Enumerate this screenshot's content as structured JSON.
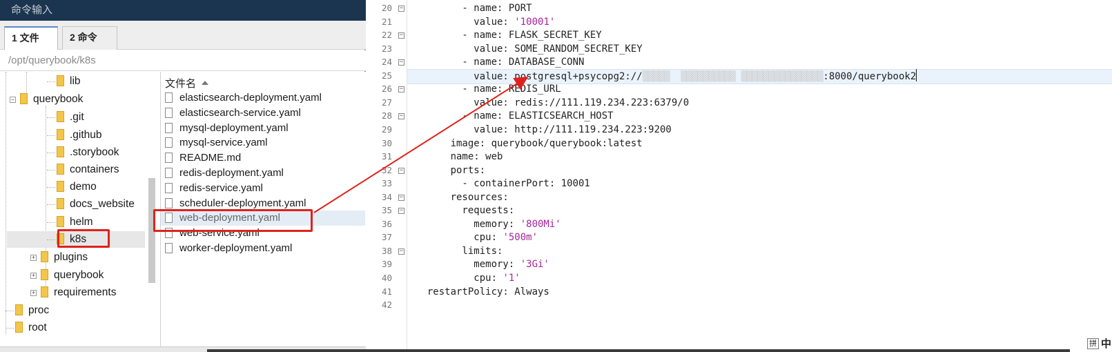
{
  "window": {
    "title": "命令输入"
  },
  "tabs": [
    {
      "label": "1 文件"
    },
    {
      "label": "2 命令"
    }
  ],
  "path": "/opt/querybook/k8s",
  "tree": {
    "items": [
      {
        "label": "lib"
      },
      {
        "label": "querybook",
        "expander": "−"
      },
      {
        "label": ".git"
      },
      {
        "label": ".github"
      },
      {
        "label": ".storybook"
      },
      {
        "label": "containers"
      },
      {
        "label": "demo"
      },
      {
        "label": "docs_website"
      },
      {
        "label": "helm"
      },
      {
        "label": "k8s"
      },
      {
        "label": "plugins",
        "expander": "+"
      },
      {
        "label": "querybook",
        "expander": "+"
      },
      {
        "label": "requirements",
        "expander": "+"
      },
      {
        "label": "proc"
      },
      {
        "label": "root"
      }
    ]
  },
  "filelist": {
    "column_header": "文件名",
    "files": [
      "elasticsearch-deployment.yaml",
      "elasticsearch-service.yaml",
      "mysql-deployment.yaml",
      "mysql-service.yaml",
      "README.md",
      "redis-deployment.yaml",
      "redis-service.yaml",
      "scheduler-deployment.yaml",
      "web-deployment.yaml",
      "web-service.yaml",
      "worker-deployment.yaml"
    ],
    "selected": "web-deployment.yaml"
  },
  "editor": {
    "lines": [
      {
        "n": "20",
        "fold": "−",
        "text": "        - name: PORT"
      },
      {
        "n": "21",
        "text": "          value: ",
        "str": "'10001'"
      },
      {
        "n": "22",
        "fold": "−",
        "text": "        - name: FLASK_SECRET_KEY"
      },
      {
        "n": "23",
        "text": "          value: SOME_RANDOM_SECRET_KEY"
      },
      {
        "n": "24",
        "fold": "−",
        "text": "        - name: DATABASE_CONN"
      },
      {
        "n": "25",
        "text": "          value: postgresql+psycopg2://",
        "blur": "▒▒▒▒▒  ▒▒▒▒▒▒▒▒▒▒ ▒▒▒▒▒▒▒▒▒▒▒▒▒▒▒",
        "tail": ":8000/querybook2"
      },
      {
        "n": "26",
        "fold": "−",
        "text": "        - name: REDIS_URL"
      },
      {
        "n": "27",
        "text": "          value: redis://111.119.234.223:6379/0"
      },
      {
        "n": "28",
        "fold": "−",
        "text": "        - name: ELASTICSEARCH_HOST"
      },
      {
        "n": "29",
        "text": "          value: http://111.119.234.223:9200"
      },
      {
        "n": "30",
        "text": "      image: querybook/querybook:latest"
      },
      {
        "n": "31",
        "text": "      name: web"
      },
      {
        "n": "32",
        "fold": "−",
        "text": "      ports:"
      },
      {
        "n": "33",
        "text": "        - containerPort: 10001"
      },
      {
        "n": "34",
        "fold": "−",
        "text": "      resources:"
      },
      {
        "n": "35",
        "fold": "−",
        "text": "        requests:"
      },
      {
        "n": "36",
        "text": "          memory: ",
        "str": "'800Mi'"
      },
      {
        "n": "37",
        "text": "          cpu: ",
        "str": "'500m'"
      },
      {
        "n": "38",
        "fold": "−",
        "text": "        limits:"
      },
      {
        "n": "39",
        "text": "          memory: ",
        "str": "'3Gi'"
      },
      {
        "n": "40",
        "text": "          cpu: ",
        "str": "'1'"
      },
      {
        "n": "41",
        "text": "  restartPolicy: Always"
      },
      {
        "n": "42",
        "text": ""
      }
    ]
  },
  "ime": {
    "mode_icon": "拼",
    "lang": "中"
  },
  "colors": {
    "annotation_red": "#e0211b",
    "string_magenta": "#a6249a",
    "titlebar": "#1b3550"
  }
}
